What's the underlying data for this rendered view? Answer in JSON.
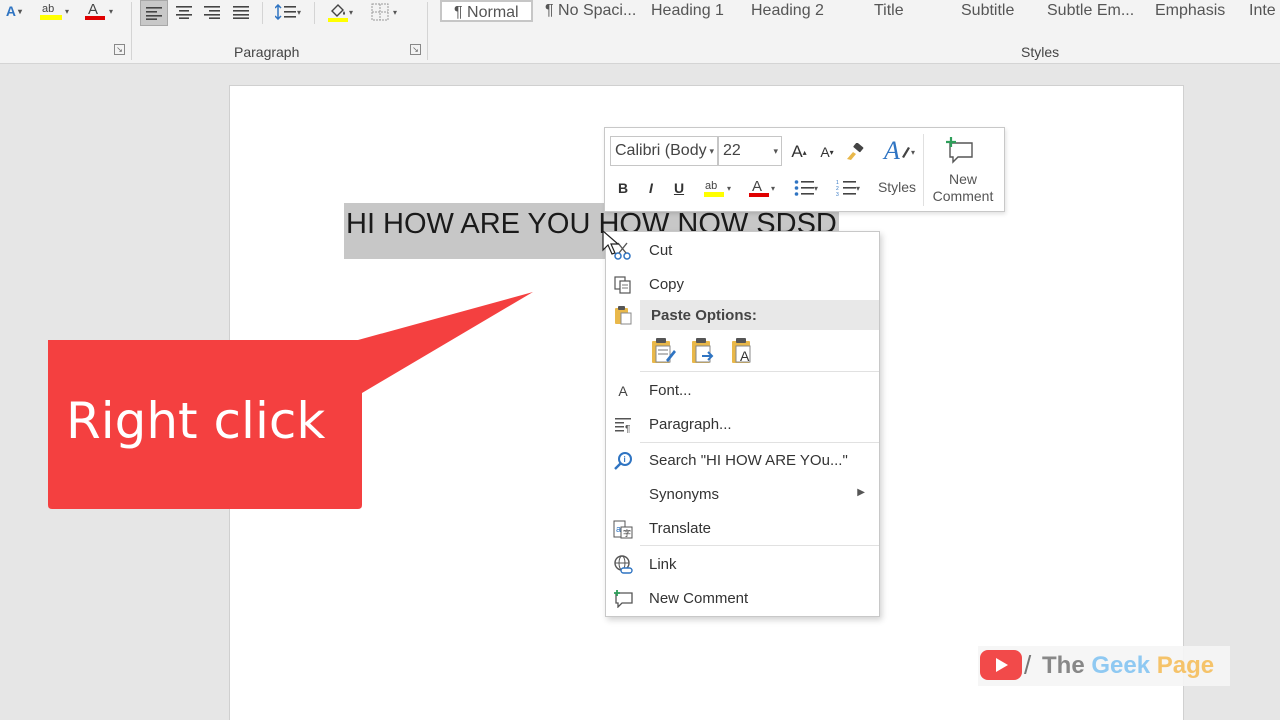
{
  "ribbon": {
    "paragraph_group_label": "Paragraph",
    "styles_group_label": "Styles",
    "styles": [
      "¶ Normal",
      "¶ No Spaci...",
      "Heading 1",
      "Heading 2",
      "Title",
      "Subtitle",
      "Subtle Em...",
      "Emphasis",
      "Inte"
    ],
    "selected_style": "¶ Normal"
  },
  "document": {
    "selected_text": "HI HOW ARE YOU HOW NOW SDSD"
  },
  "mini_toolbar": {
    "font_name": "Calibri (Body",
    "font_size": "22",
    "styles_label": "Styles",
    "new_comment_label_1": "New",
    "new_comment_label_2": "Comment",
    "bold": "B",
    "italic": "I",
    "underline": "U",
    "highlight_color": "#ffff00",
    "font_color": "#e00000"
  },
  "context_menu": {
    "cut": "Cut",
    "copy": "Copy",
    "paste_options": "Paste Options:",
    "font": "Font...",
    "paragraph": "Paragraph...",
    "search": "Search \"HI HOW ARE YOu...\"",
    "synonyms": "Synonyms",
    "translate": "Translate",
    "link": "Link",
    "new_comment": "New Comment"
  },
  "callout": {
    "text": "Right click",
    "color": "#f44040"
  },
  "watermark": {
    "text_the": "The ",
    "text_geek": "Geek",
    "text_page": " Page",
    "youtube_color": "#f24a4a"
  },
  "icons": [
    "align-left-icon",
    "align-center-icon",
    "align-right-icon",
    "justify-icon",
    "line-spacing-icon",
    "shading-icon",
    "borders-icon",
    "highlight-icon",
    "font-color-icon",
    "grow-font-icon",
    "shrink-font-icon",
    "format-painter-icon",
    "bullets-icon",
    "numbering-icon",
    "scissors-icon",
    "copy-icon",
    "paste-icon",
    "font-icon",
    "paragraph-icon",
    "search-icon",
    "translate-icon",
    "link-icon",
    "comment-icon",
    "youtube-icon"
  ]
}
